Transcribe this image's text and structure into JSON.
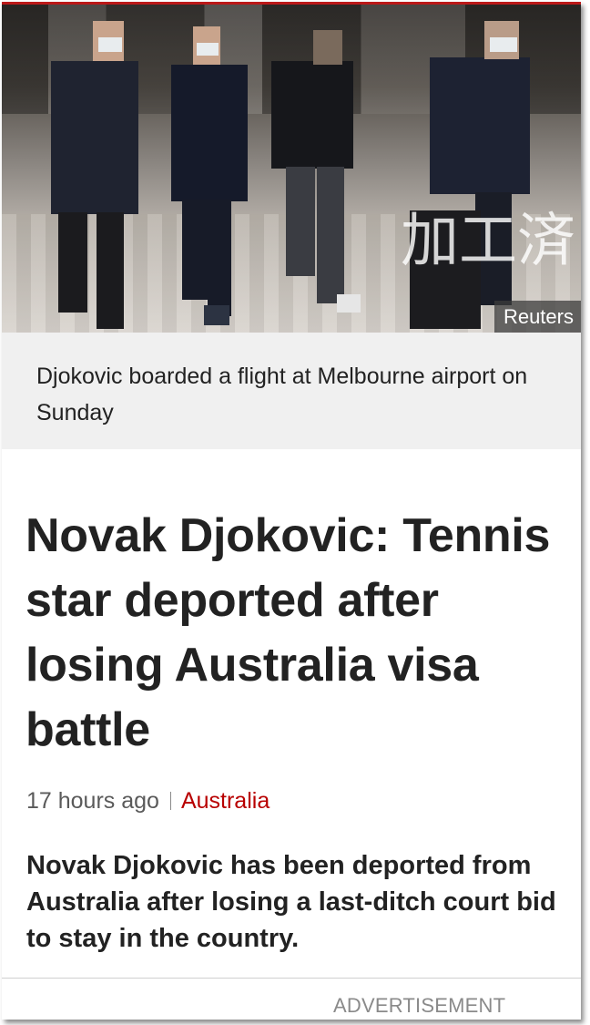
{
  "hero": {
    "watermark": "加工済",
    "credit": "Reuters"
  },
  "caption": "Djokovic boarded a flight at Melbourne airport on Sunday",
  "headline": "Novak Djokovic: Tennis star deported after losing Australia visa battle",
  "meta": {
    "timestamp": "17 hours ago",
    "category": "Australia",
    "category_color": "#b80000"
  },
  "summary": "Novak Djokovic has been deported from Australia after losing a last-ditch court bid to stay in the country.",
  "advertisement_label": "ADVERTISEMENT",
  "accent_color": "#bb1919"
}
